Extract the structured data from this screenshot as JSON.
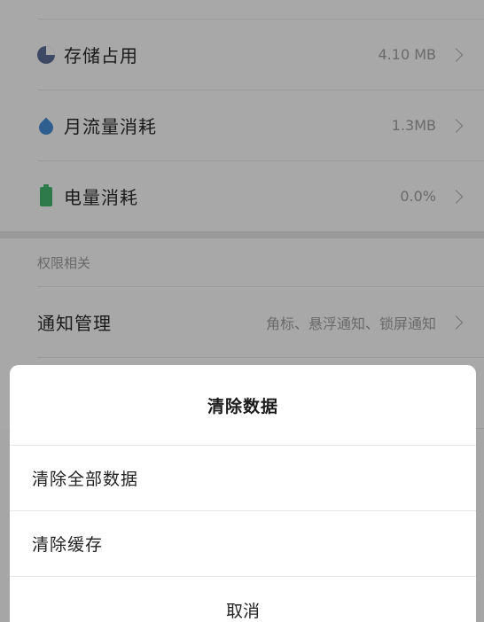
{
  "settings": {
    "usage_rows": [
      {
        "label": "存储占用",
        "value": "4.10 MB",
        "icon": "pie-chart-icon"
      },
      {
        "label": "月流量消耗",
        "value": "1.3MB",
        "icon": "water-drop-icon"
      },
      {
        "label": "电量消耗",
        "value": "0.0%",
        "icon": "battery-icon"
      }
    ],
    "permissions_header": "权限相关",
    "notification": {
      "label": "通知管理",
      "value": "角标、悬浮通知、锁屏通知"
    }
  },
  "dialog": {
    "title": "清除数据",
    "options": [
      "清除全部数据",
      "清除缓存"
    ],
    "cancel_label": "取消"
  },
  "colors": {
    "overlay_bg": "#a8a8a8",
    "sheet_bg": "#ffffff",
    "storage_icon": "#3e4a64",
    "traffic_icon": "#2f5f8e",
    "battery_icon": "#2f7a4a"
  }
}
